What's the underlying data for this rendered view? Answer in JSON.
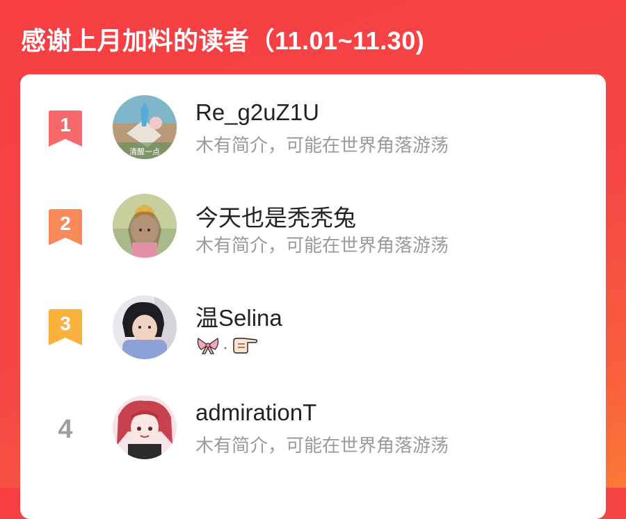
{
  "page_title": "感谢上月加料的读者（11.01~11.30)",
  "colors": {
    "background": "#f54745",
    "rank1": "#f8696c",
    "rank2": "#fb8a5a",
    "rank3": "#fbb23c",
    "rank_plain": "#9e9e9e"
  },
  "readers": [
    {
      "rank": "1",
      "name": "Re_g2uZ1U",
      "bio": "木有简介，可能在世界角落游荡",
      "avatar_text": "清醒一点"
    },
    {
      "rank": "2",
      "name": "今天也是秃秃兔",
      "bio": "木有简介，可能在世界角落游荡"
    },
    {
      "rank": "3",
      "name": "温Selina",
      "bio_icons": [
        "ribbon-emoji-icon",
        "pointing-hand-emoji-icon"
      ]
    },
    {
      "rank": "4",
      "name": "admirationT",
      "bio": "木有简介，可能在世界角落游荡"
    }
  ]
}
